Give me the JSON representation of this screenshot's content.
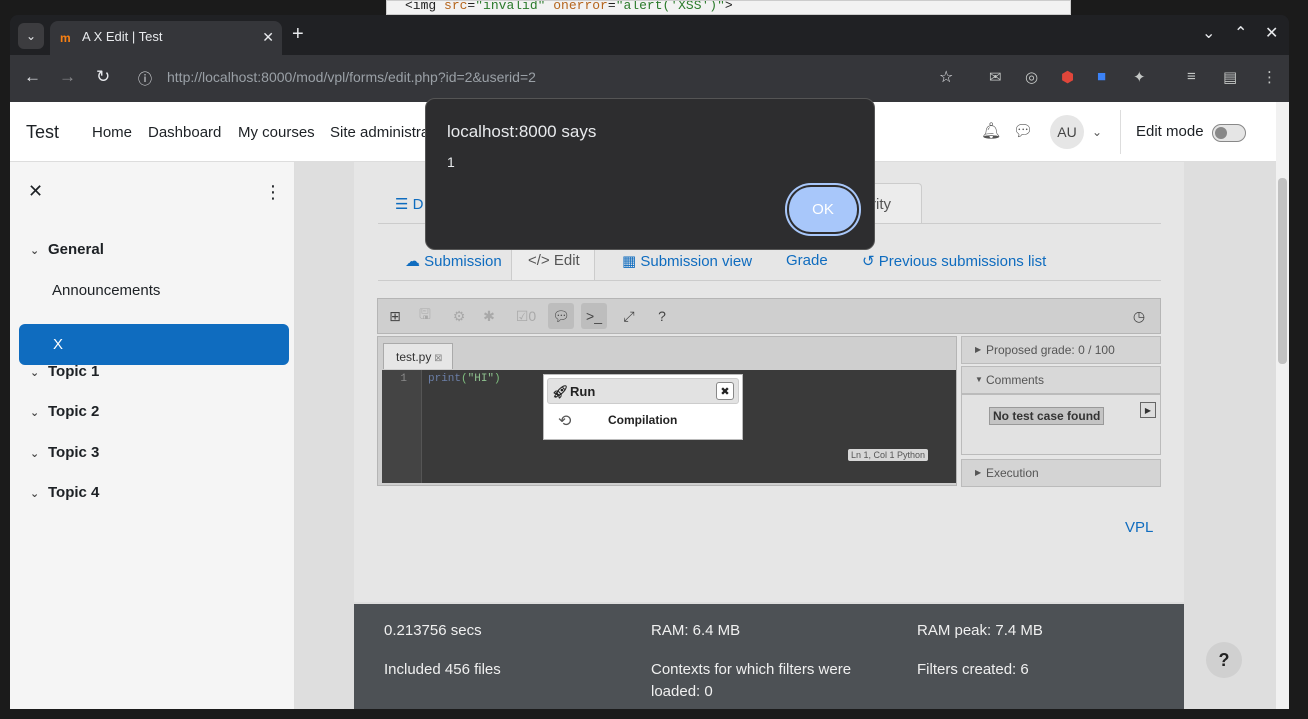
{
  "background_code": {
    "prefix": "<img ",
    "attr1": "src",
    "eq": "=",
    "val1": "\"invalid\"",
    "attr2": " onerror",
    "val2": "\"alert('XSS')\"",
    "suffix": ">"
  },
  "browser": {
    "tab_title": "A X Edit | Test",
    "url_host": "http://localhost",
    "url_rest": ":8000/mod/vpl/forms/edit.php?id=2&userid=2"
  },
  "navbar": {
    "site_name": "Test",
    "items": [
      "Home",
      "Dashboard",
      "My courses",
      "Site administration"
    ],
    "avatar_initials": "AU",
    "edit_mode_label": "Edit mode"
  },
  "drawer": {
    "sections": [
      {
        "label": "General",
        "expanded": true
      },
      {
        "label": "Topic 1"
      },
      {
        "label": "Topic 2"
      },
      {
        "label": "Topic 3"
      },
      {
        "label": "Topic 4"
      }
    ],
    "items": [
      "Announcements",
      "X"
    ]
  },
  "tabs_primary": {
    "first": "D",
    "active": "rity"
  },
  "tabs_secondary": [
    "Submission",
    "Edit",
    "Submission view",
    "Grade",
    "Previous submissions list"
  ],
  "editor": {
    "file_name": "test.py",
    "tests_count": "0",
    "line_number": "1",
    "code_fn": "print",
    "code_str": "\"HI\"",
    "status": "Ln 1, Col 1 Python"
  },
  "side_panel": {
    "proposed_grade": "Proposed grade: 0 / 100",
    "comments": "Comments",
    "no_test": "No test case found",
    "execution": "Execution"
  },
  "run_popup": {
    "title": "Run",
    "status": "Compilation"
  },
  "vpl_link": "VPL",
  "footer": {
    "secs": "0.213756 secs",
    "ram": "RAM: 6.4 MB",
    "ram_peak": "RAM peak: 7.4 MB",
    "files": "Included 456 files",
    "contexts": "Contexts for which filters were loaded: 0",
    "filters": "Filters created: 6"
  },
  "help": "?",
  "alert": {
    "title": "localhost:8000 says",
    "message": "1",
    "ok": "OK"
  }
}
